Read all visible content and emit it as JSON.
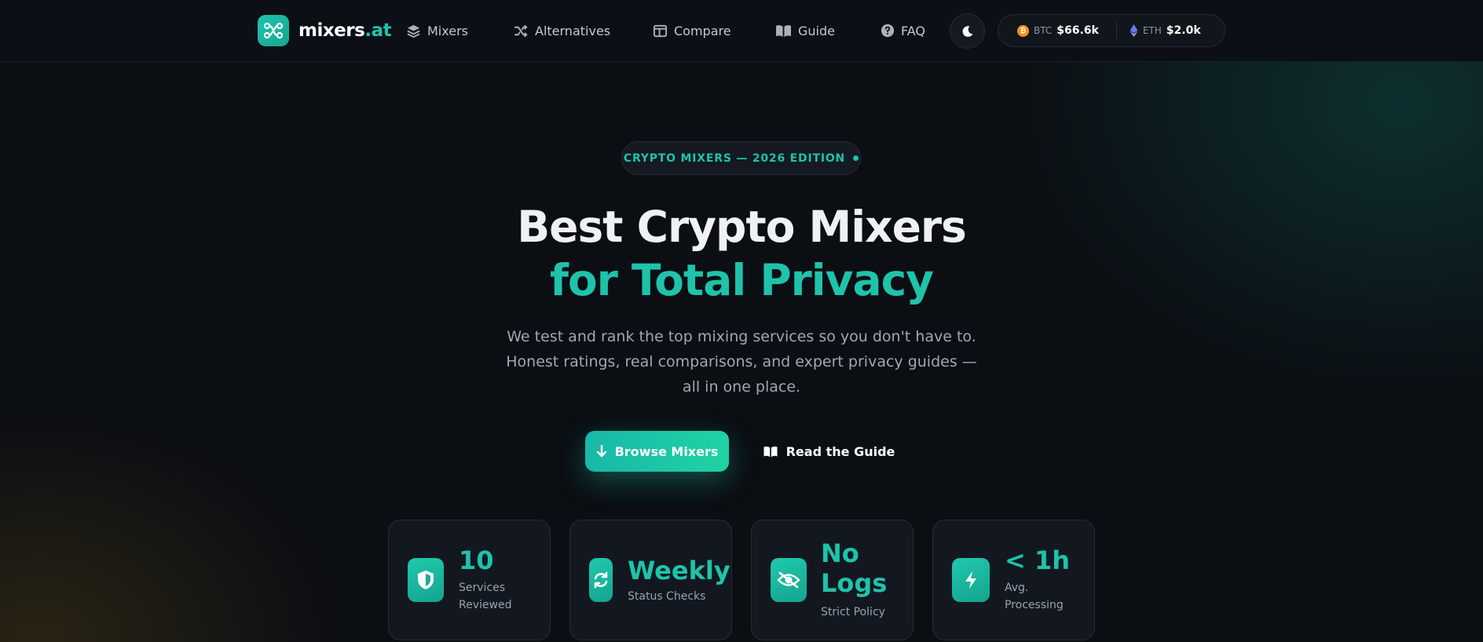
{
  "brand": {
    "name": "mixers",
    "tld": ".at",
    "accent": "#1ec3aa"
  },
  "nav": {
    "items": [
      {
        "label": "Mixers",
        "icon": "layers-icon"
      },
      {
        "label": "Alternatives",
        "icon": "shuffle-icon"
      },
      {
        "label": "Compare",
        "icon": "columns-icon"
      },
      {
        "label": "Guide",
        "icon": "book-icon"
      },
      {
        "label": "FAQ",
        "icon": "question-circle-icon"
      }
    ],
    "theme_toggle_icon": "moon-icon"
  },
  "prices": {
    "btc": {
      "symbol": "BTC",
      "value": "$66.6k",
      "color": "#f7931a"
    },
    "eth": {
      "symbol": "ETH",
      "value": "$2.0k",
      "color": "#627eea"
    }
  },
  "hero": {
    "badge": "CRYPTO MIXERS — 2026 EDITION",
    "title_line1": "Best Crypto Mixers",
    "title_line2": "for Total Privacy",
    "subtitle": "We test and rank the top mixing services so you don't have to. Honest ratings, real comparisons, and expert privacy guides — all in one place.",
    "primary_cta": "Browse Mixers",
    "secondary_cta": "Read the Guide"
  },
  "stats": [
    {
      "value": "10",
      "label": "Services Reviewed",
      "icon": "shield-icon"
    },
    {
      "value": "Weekly",
      "label": "Status Checks",
      "icon": "refresh-icon"
    },
    {
      "value": "No Logs",
      "label": "Strict Policy",
      "icon": "eye-off-icon"
    },
    {
      "value": "< 1h",
      "label": "Avg. Processing",
      "icon": "bolt-icon"
    }
  ]
}
